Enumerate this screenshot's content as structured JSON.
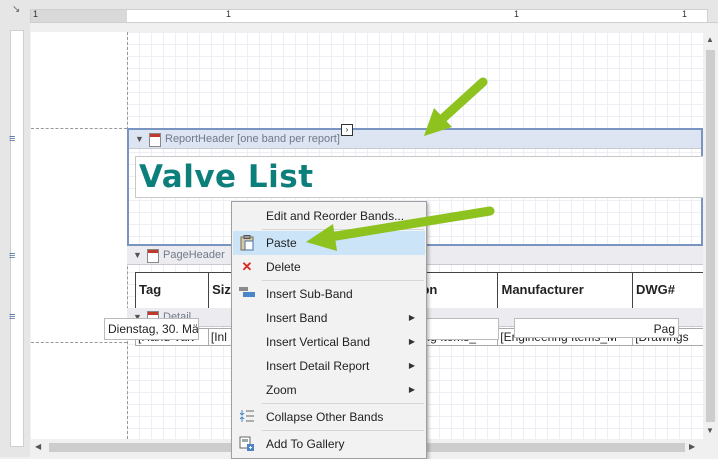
{
  "ruler": {
    "numbers": [
      "1",
      "1",
      "1",
      "1"
    ]
  },
  "report_header": {
    "band_label": "ReportHeader [one band per report]",
    "title": "Valve List"
  },
  "page_header": {
    "band_label": "PageHeader",
    "columns": [
      "Tag",
      "Size",
      "",
      "ion",
      "Manufacturer",
      "DWG#"
    ]
  },
  "detail": {
    "band_label": "Detail",
    "cells": [
      "[Hand Valv",
      "[Inl",
      "",
      "ring Items_",
      "[Engineering Items_M",
      "[Drawings"
    ]
  },
  "footer": {
    "date": "Dienstag, 30. März",
    "page": "Pag"
  },
  "context_menu": {
    "items": [
      {
        "label": "Edit and Reorder Bands...",
        "icon": ""
      },
      {
        "label": "Paste",
        "icon": "paste-icon"
      },
      {
        "label": "Delete",
        "icon": "delete-icon"
      },
      {
        "label": "Insert Sub-Band",
        "icon": "insert-sub-band-icon"
      },
      {
        "label": "Insert Band",
        "icon": ""
      },
      {
        "label": "Insert Vertical Band",
        "icon": ""
      },
      {
        "label": "Insert Detail Report",
        "icon": ""
      },
      {
        "label": "Zoom",
        "icon": ""
      },
      {
        "label": "Collapse Other Bands",
        "icon": "collapse-icon"
      },
      {
        "label": "Add To Gallery",
        "icon": "gallery-icon"
      }
    ],
    "highlighted": "Paste"
  },
  "colors": {
    "title": "#0d7f7b",
    "arrow": "#8dc21f",
    "selected_border": "#7a94c2",
    "menu_highlight": "#cce4f7",
    "delete": "#d9281f"
  }
}
